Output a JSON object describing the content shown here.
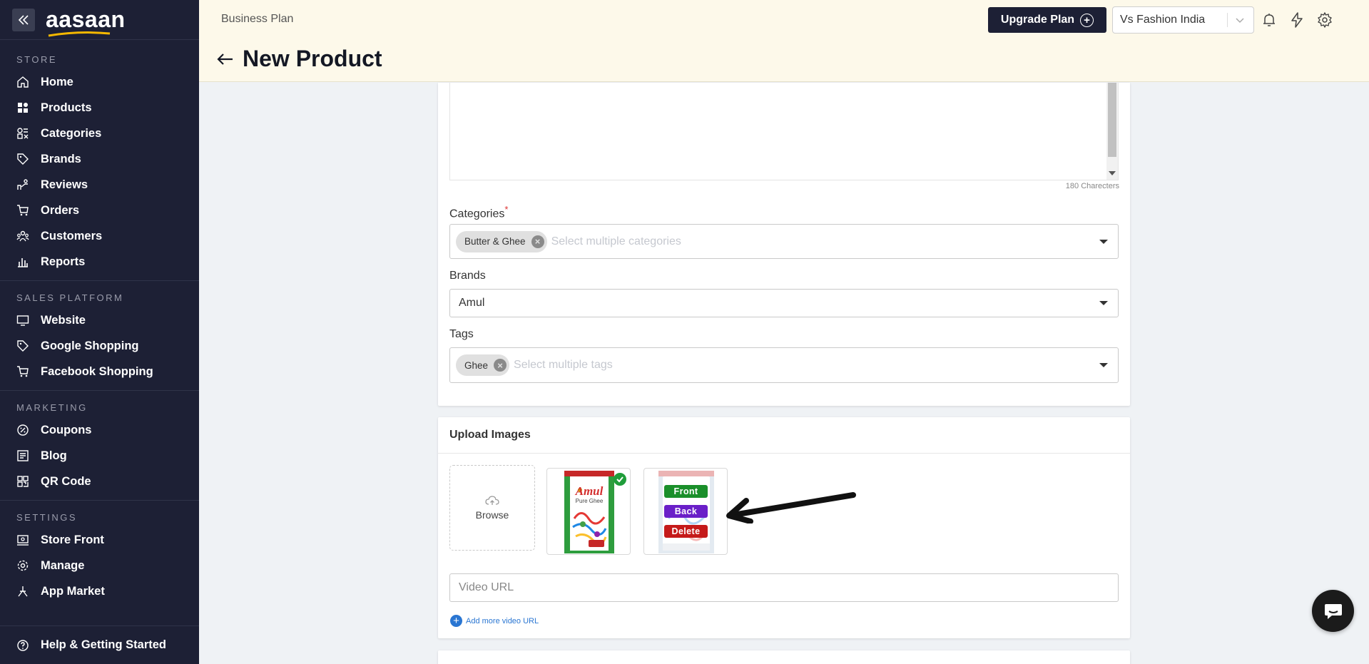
{
  "app": {
    "logo_text": "aasaan",
    "accent_color": "#1d2035",
    "logo_accent": "#f5b800"
  },
  "sidebar": {
    "sections": [
      {
        "title": "STORE",
        "items": [
          {
            "label": "Home",
            "icon": "home-icon"
          },
          {
            "label": "Products",
            "icon": "products-icon"
          },
          {
            "label": "Categories",
            "icon": "categories-icon"
          },
          {
            "label": "Brands",
            "icon": "tag-icon"
          },
          {
            "label": "Reviews",
            "icon": "reviews-icon"
          },
          {
            "label": "Orders",
            "icon": "cart-icon"
          },
          {
            "label": "Customers",
            "icon": "customers-icon"
          },
          {
            "label": "Reports",
            "icon": "bar-chart-icon"
          }
        ]
      },
      {
        "title": "SALES PLATFORM",
        "items": [
          {
            "label": "Website",
            "icon": "monitor-icon"
          },
          {
            "label": "Google Shopping",
            "icon": "tag-icon"
          },
          {
            "label": "Facebook Shopping",
            "icon": "cart-icon"
          }
        ]
      },
      {
        "title": "MARKETING",
        "items": [
          {
            "label": "Coupons",
            "icon": "coupon-icon"
          },
          {
            "label": "Blog",
            "icon": "blog-icon"
          },
          {
            "label": "QR Code",
            "icon": "qr-code-icon"
          }
        ]
      },
      {
        "title": "SETTINGS",
        "items": [
          {
            "label": "Store Front",
            "icon": "storefront-icon"
          },
          {
            "label": "Manage",
            "icon": "gear-icon"
          },
          {
            "label": "App Market",
            "icon": "app-market-icon"
          }
        ]
      }
    ],
    "help_label": "Help & Getting Started"
  },
  "header": {
    "plan": "Business Plan",
    "page_title": "New Product",
    "upgrade_label": "Upgrade Plan",
    "store_name": "Vs Fashion India"
  },
  "form": {
    "char_count": "180 Charecters",
    "categories": {
      "label": "Categories",
      "required_mark": "*",
      "chips": [
        "Butter & Ghee"
      ],
      "placeholder": "Select multiple categories"
    },
    "brands": {
      "label": "Brands",
      "value": "Amul"
    },
    "tags": {
      "label": "Tags",
      "chips": [
        "Ghee"
      ],
      "placeholder": "Select multiple tags"
    },
    "upload": {
      "title": "Upload Images",
      "browse_label": "Browse",
      "product_brand": "Amul",
      "product_name": "Pure Ghee",
      "buttons": {
        "front": "Front",
        "back": "Back",
        "delete": "Delete"
      },
      "button_colors": {
        "front": "#1a8f2a",
        "back": "#6a1fc8",
        "delete": "#c51a1a"
      }
    },
    "video": {
      "placeholder": "Video URL",
      "add_more": "Add more video URL"
    }
  }
}
